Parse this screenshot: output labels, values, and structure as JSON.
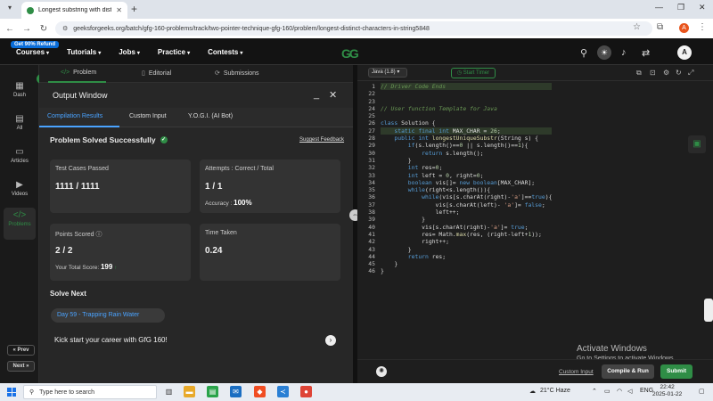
{
  "browser": {
    "tab_title": "Longest substring with distinct",
    "url": "geeksforgeeks.org/batch/gfg-160-problems/track/two-pointer-technique-gfg-160/problem/longest-distinct-characters-in-string5848",
    "profile_initial": "A"
  },
  "header": {
    "badge": "Get 90% Refund",
    "nav": [
      "Courses",
      "Tutorials",
      "Jobs",
      "Practice",
      "Contests"
    ],
    "logo": "GG",
    "avatar": "A"
  },
  "rail": {
    "items": [
      {
        "label": "Dash"
      },
      {
        "label": "All"
      },
      {
        "label": "Articles"
      },
      {
        "label": "Videos"
      },
      {
        "label": "Problems"
      }
    ],
    "prev": "Prev",
    "next": "Next"
  },
  "left_tabs": [
    "Problem",
    "Editorial",
    "Submissions"
  ],
  "output": {
    "title": "Output Window",
    "tabs": [
      "Compilation Results",
      "Custom Input",
      "Y.O.G.I. (AI Bot)"
    ],
    "status": "Problem Solved Successfully",
    "feedback": "Suggest Feedback",
    "cards": {
      "test_cases_label": "Test Cases Passed",
      "test_cases_value": "1111 / 1111",
      "attempts_label": "Attempts : Correct / Total",
      "attempts_value": "1 / 1",
      "accuracy_label": "Accuracy :",
      "accuracy_value": "100%",
      "points_label": "Points Scored",
      "points_value": "2 / 2",
      "total_score_label": "Your Total Score:",
      "total_score_value": "199",
      "time_label": "Time Taken",
      "time_value": "0.24"
    },
    "solve_next": "Solve Next",
    "next_problem": "Day 59 - Trapping Rain Water",
    "kickstart": "Kick start your career with GfG 160!"
  },
  "editor": {
    "language": "Java (1.8)",
    "timer": "Start Timer",
    "line_numbers": [
      "1",
      "22",
      "23",
      "24",
      "25",
      "26",
      "27",
      "28",
      "29",
      "30",
      "31",
      "32",
      "33",
      "34",
      "35",
      "36",
      "37",
      "38",
      "39",
      "40",
      "41",
      "42",
      "43",
      "44",
      "45",
      "46"
    ],
    "custom_input": "Custom Input",
    "compile": "Compile & Run",
    "submit": "Submit"
  },
  "watermark": {
    "line1": "Activate Windows",
    "line2": "Go to Settings to activate Windows."
  },
  "taskbar": {
    "search": "Type here to search",
    "weather": "21°C  Haze",
    "lang": "ENG",
    "time": "22:42",
    "date": "2025-01-22"
  }
}
